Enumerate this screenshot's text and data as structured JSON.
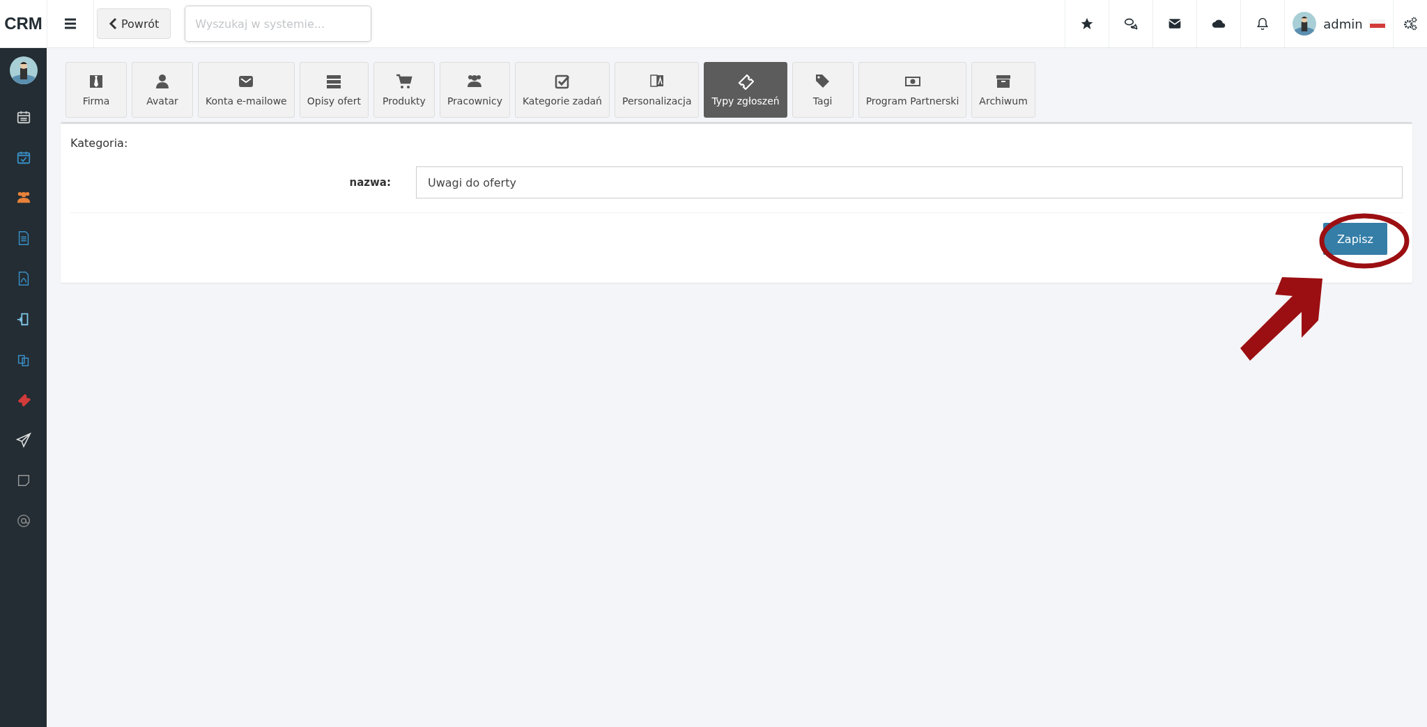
{
  "topbar": {
    "logo": "CRM",
    "back_button": "Powrót",
    "search": {
      "placeholder": "Wyszukaj w systemie..."
    },
    "user": {
      "name": "admin"
    }
  },
  "tabs": [
    {
      "label": "Firma",
      "selected": false
    },
    {
      "label": "Avatar",
      "selected": false
    },
    {
      "label": "Konta e-mailowe",
      "selected": false
    },
    {
      "label": "Opisy ofert",
      "selected": false
    },
    {
      "label": "Produkty",
      "selected": false
    },
    {
      "label": "Pracownicy",
      "selected": false
    },
    {
      "label": "Kategorie zadań",
      "selected": false
    },
    {
      "label": "Personalizacja",
      "selected": false
    },
    {
      "label": "Typy zgłoszeń",
      "selected": true
    },
    {
      "label": "Tagi",
      "selected": false
    },
    {
      "label": "Program Partnerski",
      "selected": false
    },
    {
      "label": "Archiwum",
      "selected": false
    }
  ],
  "form": {
    "title": "Kategoria:",
    "field_label": "nazwa:",
    "field_value": "Uwagi do oferty",
    "save_button": "Zapisz"
  }
}
